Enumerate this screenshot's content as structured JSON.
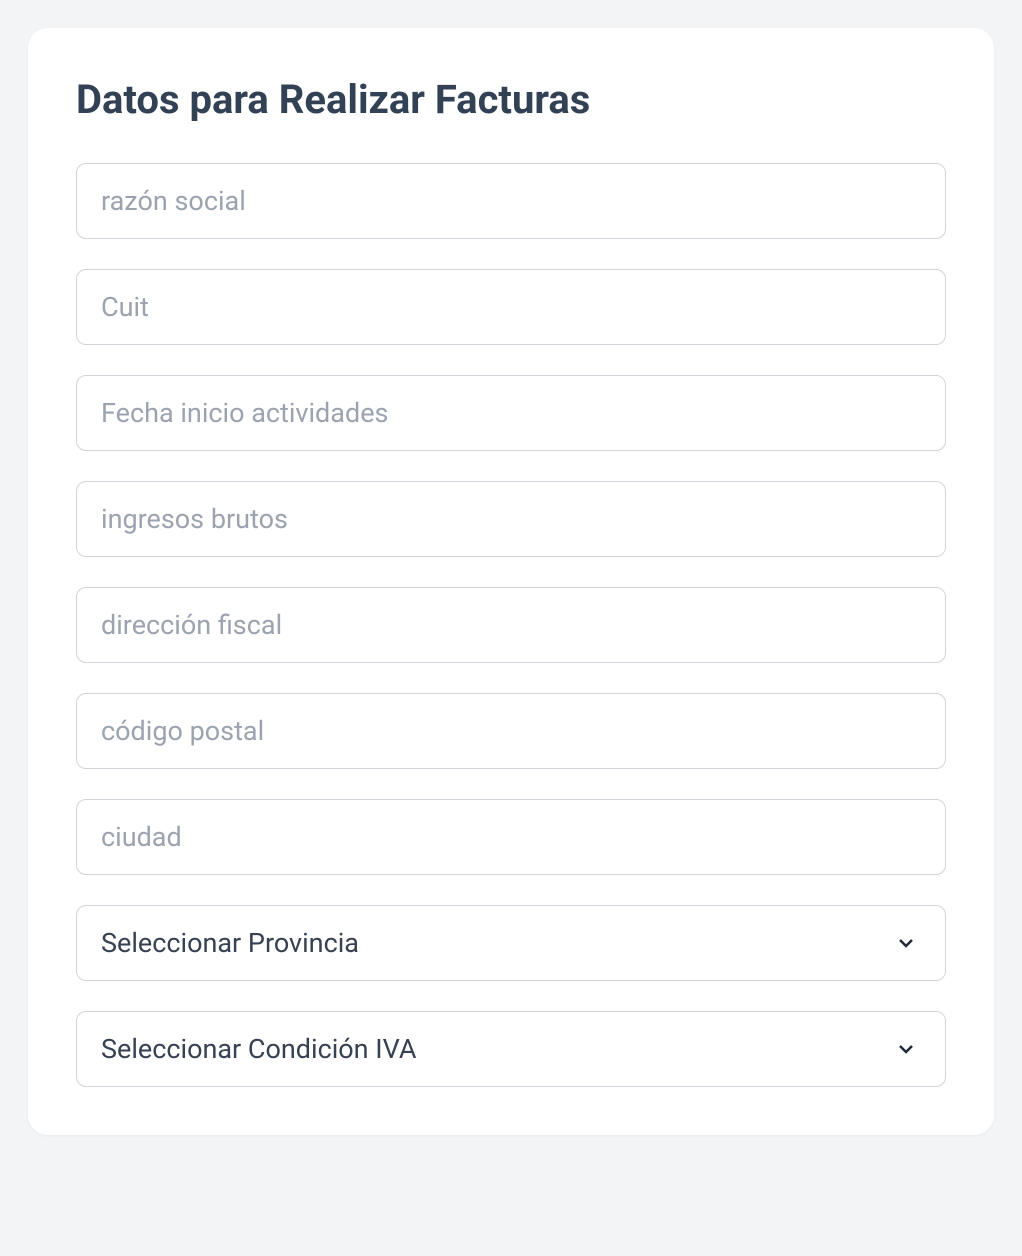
{
  "form": {
    "title": "Datos para Realizar Facturas",
    "fields": {
      "razon_social": {
        "placeholder": "razón social",
        "value": ""
      },
      "cuit": {
        "placeholder": "Cuit",
        "value": ""
      },
      "fecha_inicio": {
        "placeholder": "Fecha inicio actividades",
        "value": ""
      },
      "ingresos_brutos": {
        "placeholder": "ingresos brutos",
        "value": ""
      },
      "direccion_fiscal": {
        "placeholder": "dirección fiscal",
        "value": ""
      },
      "codigo_postal": {
        "placeholder": "código postal",
        "value": ""
      },
      "ciudad": {
        "placeholder": "ciudad",
        "value": ""
      },
      "provincia": {
        "selected": "Seleccionar Provincia"
      },
      "condicion_iva": {
        "selected": "Seleccionar Condición IVA"
      }
    }
  }
}
